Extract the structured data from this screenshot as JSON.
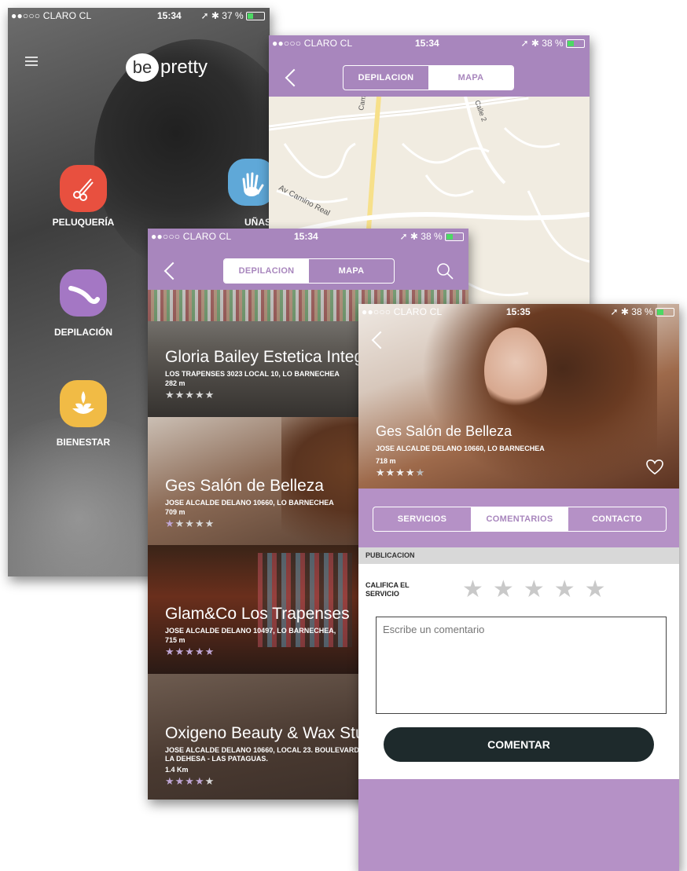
{
  "status_bars": {
    "home": {
      "carrier": "●●○○○ CLARO CL",
      "time": "15:34",
      "battery": "37 %"
    },
    "map": {
      "carrier": "●●○○○ CLARO CL",
      "time": "15:34",
      "battery": "38 %"
    },
    "list": {
      "carrier": "●●○○○ CLARO CL",
      "time": "15:34",
      "battery": "38 %"
    },
    "detail": {
      "carrier": "●●○○○ CLARO CL",
      "time": "15:35",
      "battery": "38 %"
    }
  },
  "home": {
    "logo_be": "be",
    "logo_pretty": "pretty",
    "categories": [
      {
        "label": "PELUQUERÍA",
        "icon": "scissors-icon",
        "color": "#e8503f"
      },
      {
        "label": "UÑAS",
        "icon": "hand-icon",
        "color": "#5fa8d8"
      },
      {
        "label": "DEPILACIÓN",
        "icon": "leg-icon",
        "color": "#a477c4"
      },
      {
        "label": "BIENESTAR",
        "icon": "lotus-icon",
        "color": "#f1bb45"
      }
    ]
  },
  "segmented": {
    "depilacion": "DEPILACION",
    "mapa": "MAPA"
  },
  "map": {
    "streets": [
      "Av Camino Real",
      "Cam",
      "Calle 2"
    ]
  },
  "list": {
    "salons": [
      {
        "name": "Gloria Bailey Estetica Integral",
        "address": "LOS TRAPENSES 3023 LOCAL 10, LO BARNECHEA",
        "distance": "282 m",
        "rating": 5
      },
      {
        "name": "Ges Salón de Belleza",
        "address": "JOSE ALCALDE DELANO 10660, LO BARNECHEA",
        "distance": "709 m",
        "rating": 4
      },
      {
        "name": "Glam&Co Los Trapenses",
        "address": "JOSE ALCALDE DELANO 10497, LO BARNECHEA,",
        "distance": "715 m",
        "rating": 5
      },
      {
        "name": "Oxigeno Beauty & Wax Studio",
        "address": "JOSE ALCALDE DELANO 10660, LOCAL 23. BOULEVARD",
        "address2": "LA DEHESA - LAS PATAGUAS.",
        "distance": "1.4 Km",
        "rating": 4
      }
    ]
  },
  "detail": {
    "name": "Ges Salón de Belleza",
    "address": "JOSE ALCALDE DELANO 10660, LO BARNECHEA",
    "distance": "718 m",
    "rating": 4,
    "tabs": [
      "SERVICIOS",
      "COMENTARIOS",
      "CONTACTO"
    ],
    "active_tab": "COMENTARIOS",
    "section_header": "PUBLICACION",
    "rate_label_1": "CALIFICA EL",
    "rate_label_2": "SERVICIO",
    "comment_placeholder": "Escribe un comentario",
    "submit_label": "COMENTAR"
  },
  "colors": {
    "accent": "#a886bd",
    "dark_button": "#1e2a2c",
    "section_gray": "#d8d8d8"
  }
}
